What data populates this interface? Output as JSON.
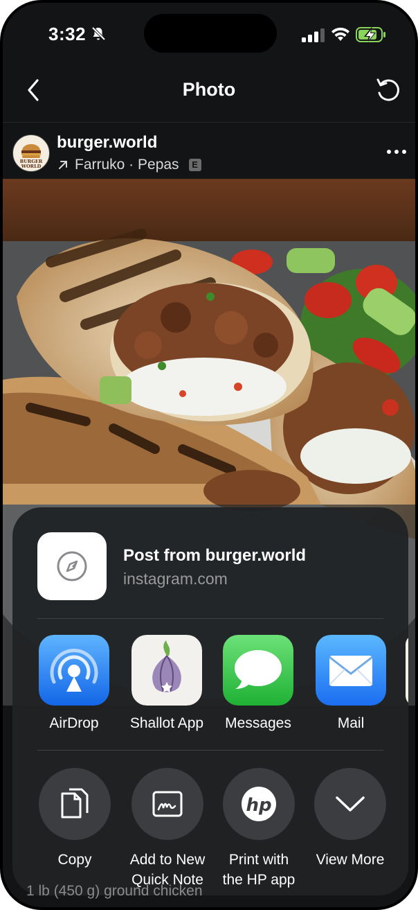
{
  "status_bar": {
    "time": "3:32"
  },
  "nav": {
    "title": "Photo"
  },
  "post": {
    "username": "burger.world",
    "avatar_text_1": "BURGER",
    "avatar_text_2": "WORLD",
    "music": "Farruko · Pepas",
    "explicit_badge": "E"
  },
  "share_sheet": {
    "link_title": "Post from burger.world",
    "link_url": "instagram.com",
    "apps": [
      {
        "label": "AirDrop",
        "icon": "airdrop-icon"
      },
      {
        "label": "Shallot App",
        "icon": "onion-icon"
      },
      {
        "label": "Messages",
        "icon": "messages-icon"
      },
      {
        "label": "Mail",
        "icon": "mail-icon"
      }
    ],
    "actions": [
      {
        "label_line1": "Copy",
        "label_line2": "",
        "icon": "copy-icon"
      },
      {
        "label_line1": "Add to New",
        "label_line2": "Quick Note",
        "icon": "quick-note-icon"
      },
      {
        "label_line1": "Print with",
        "label_line2": "the HP app",
        "icon": "hp-icon"
      },
      {
        "label_line1": "View More",
        "label_line2": "",
        "icon": "chevron-down-icon"
      }
    ]
  },
  "background_caption": "1 lb (450 g) ground chicken",
  "colors": {
    "airdrop_blue": "#1e7cf2",
    "messages_green": "#34c759",
    "mail_blue": "#2f8cf6"
  }
}
